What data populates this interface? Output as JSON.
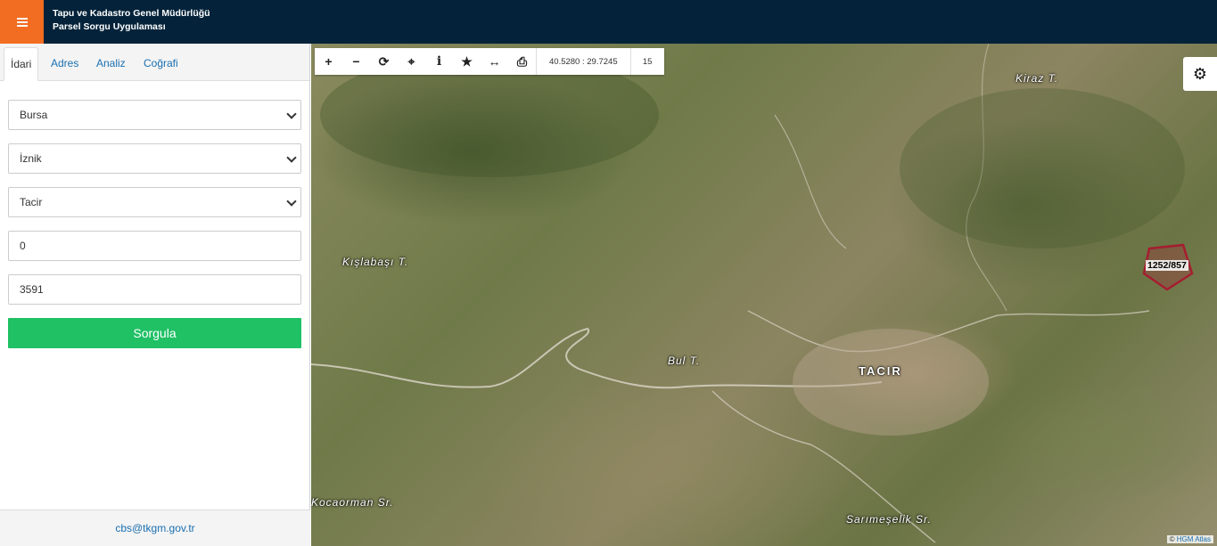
{
  "header": {
    "line1": "Tapu ve Kadastro Genel Müdürlüğü",
    "line2": "Parsel Sorgu Uygulaması",
    "menu_icon": "hamburger-icon",
    "brand_color": "#04233a",
    "accent_color": "#f26d21"
  },
  "tabs": [
    {
      "label": "İdari",
      "active": true
    },
    {
      "label": "Adres",
      "active": false
    },
    {
      "label": "Analiz",
      "active": false
    },
    {
      "label": "Coğrafi",
      "active": false
    }
  ],
  "form": {
    "province": "Bursa",
    "district": "İznik",
    "neighborhood": "Tacir",
    "block": "0",
    "parcel": "3591",
    "submit_label": "Sorgula",
    "submit_color": "#20c065"
  },
  "footer": {
    "email": "cbs@tkgm.gov.tr"
  },
  "map": {
    "coordinates": "40.5280 : 29.7245",
    "zoom": "15",
    "tools": [
      "plus-icon",
      "minus-icon",
      "refresh-icon",
      "crosshair-icon",
      "info-icon",
      "star-icon",
      "measure-icon",
      "print-icon"
    ],
    "places": [
      "Kiraz T.",
      "Kışlabaşı T.",
      "Bul T.",
      "TACIR",
      "Kocaorman Sr.",
      "Sarımeşelik Sr."
    ],
    "parcel_label": "1252/857",
    "attribution_prefix": "©",
    "attribution_link": "HGM Atlas"
  }
}
